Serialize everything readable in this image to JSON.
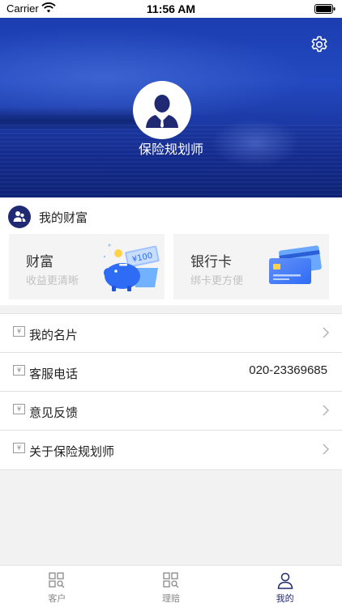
{
  "status_bar": {
    "carrier": "Carrier",
    "time": "11:56 AM"
  },
  "header": {
    "title": "保险规划师",
    "settings_icon": "gear-icon",
    "avatar_icon": "businessman-avatar-icon"
  },
  "wealth": {
    "title": "我的财富",
    "cards": [
      {
        "title": "财富",
        "subtitle": "收益更清晰",
        "art_text": "¥100",
        "icon": "piggy-bank-icon"
      },
      {
        "title": "银行卡",
        "subtitle": "绑卡更方便",
        "icon": "bank-cards-icon"
      }
    ]
  },
  "menu": [
    {
      "label": "我的名片",
      "value": "",
      "icon": "yen-note-icon"
    },
    {
      "label": "客服电话",
      "value": "020-23369685",
      "icon": "yen-note-icon"
    },
    {
      "label": "意见反馈",
      "value": "",
      "icon": "yen-note-icon"
    },
    {
      "label": "关于保险规划师",
      "value": "",
      "icon": "yen-note-icon"
    }
  ],
  "menu_icon_glyph": "¥",
  "tabs": [
    {
      "label": "客户",
      "active": false
    },
    {
      "label": "理赔",
      "active": false
    },
    {
      "label": "我的",
      "active": true
    }
  ],
  "colors": {
    "brand": "#1f2a72",
    "hero_blue": "#1b3db0",
    "tab_inactive": "#888888"
  }
}
